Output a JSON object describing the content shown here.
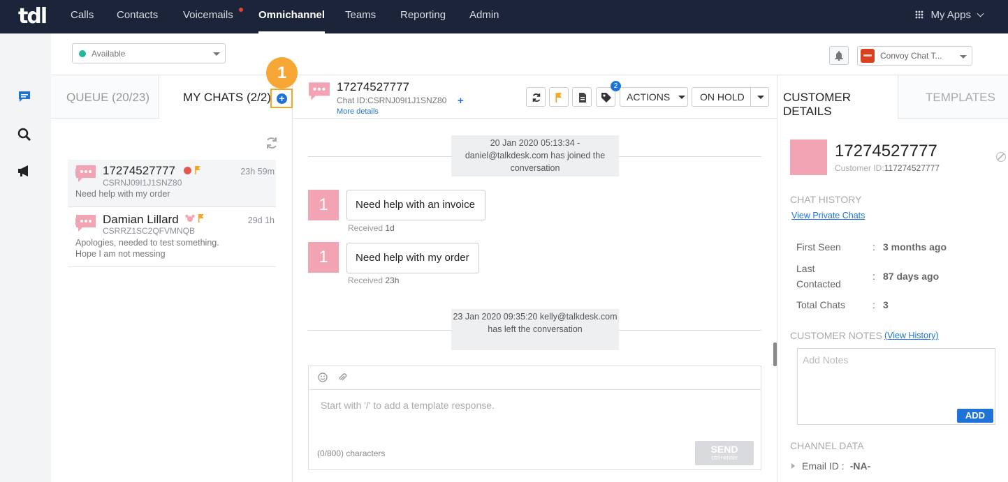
{
  "nav": {
    "logo": "tdl",
    "items": [
      {
        "label": "Calls"
      },
      {
        "label": "Contacts"
      },
      {
        "label": "Voicemails"
      },
      {
        "label": "Omnichannel"
      },
      {
        "label": "Teams"
      },
      {
        "label": "Reporting"
      },
      {
        "label": "Admin"
      }
    ],
    "my_apps": "My Apps"
  },
  "status": {
    "value": "Available",
    "color": "#21b79c"
  },
  "integration": {
    "label": "Convoy Chat T..."
  },
  "tabs": {
    "queue": "QUEUE (20/23)",
    "my_chats": "MY CHATS (2/2)"
  },
  "add_chat_symbol": "+",
  "step_badge": "1",
  "chats": [
    {
      "name": "17274527777",
      "id": "CSRNJ09I1J1SNZ80",
      "preview": "Need help with my order",
      "time": "23h 59m"
    },
    {
      "name": "Damian Lillard",
      "id": "CSRRZ1SC2QFVMNQB",
      "preview": "Apologies, needed to test something. Hope I am not messing",
      "time": "29d 1h"
    }
  ],
  "conversation": {
    "name": "17274527777",
    "chat_id": "Chat ID:CSRNJ09I1J1SNZ80",
    "plus": "+",
    "more": "More details",
    "tag_count": "2",
    "actions": "ACTIONS",
    "hold": "ON HOLD",
    "sys1": "20 Jan 2020 05:13:34 - daniel@talkdesk.com has joined the conversation",
    "sys2": "23 Jan 2020 09:35:20 kelly@talkdesk.com has left the conversation",
    "messages": [
      {
        "avatar": "1",
        "text": "Need help with an invoice",
        "received_label": "Received",
        "received_time": "1d"
      },
      {
        "avatar": "1",
        "text": "Need help with my order",
        "received_label": "Received",
        "received_time": "23h"
      }
    ],
    "placeholder": "Start with '/' to add a template response.",
    "char_count": "(0/800) characters",
    "send": "SEND",
    "send_hint": "ctrl+enter"
  },
  "customer": {
    "tab_details": "CUSTOMER DETAILS",
    "tab_templates": "TEMPLATES",
    "name": "17274527777",
    "id_label": "Customer ID:",
    "id_value": "117274527777",
    "chat_history": "CHAT HISTORY",
    "view_private": "View Private Chats",
    "first_seen_k": "First Seen",
    "first_seen_v": "3 months ago",
    "last_contacted_k": "Last Contacted",
    "last_contacted_v": "87 days ago",
    "total_chats_k": "Total Chats",
    "total_chats_v": "3",
    "colon": ":",
    "notes_title": "CUSTOMER NOTES",
    "view_history": "(View History)",
    "notes_placeholder": "Add Notes",
    "add": "ADD",
    "channel_data": "CHANNEL DATA",
    "email_k": "Email ID :",
    "email_v": "-NA-"
  },
  "colors": {
    "accent": "#1f73d8",
    "nav_bg": "#1b2438",
    "avatar": "#f3a4b4",
    "highlight": "#f5a623"
  }
}
